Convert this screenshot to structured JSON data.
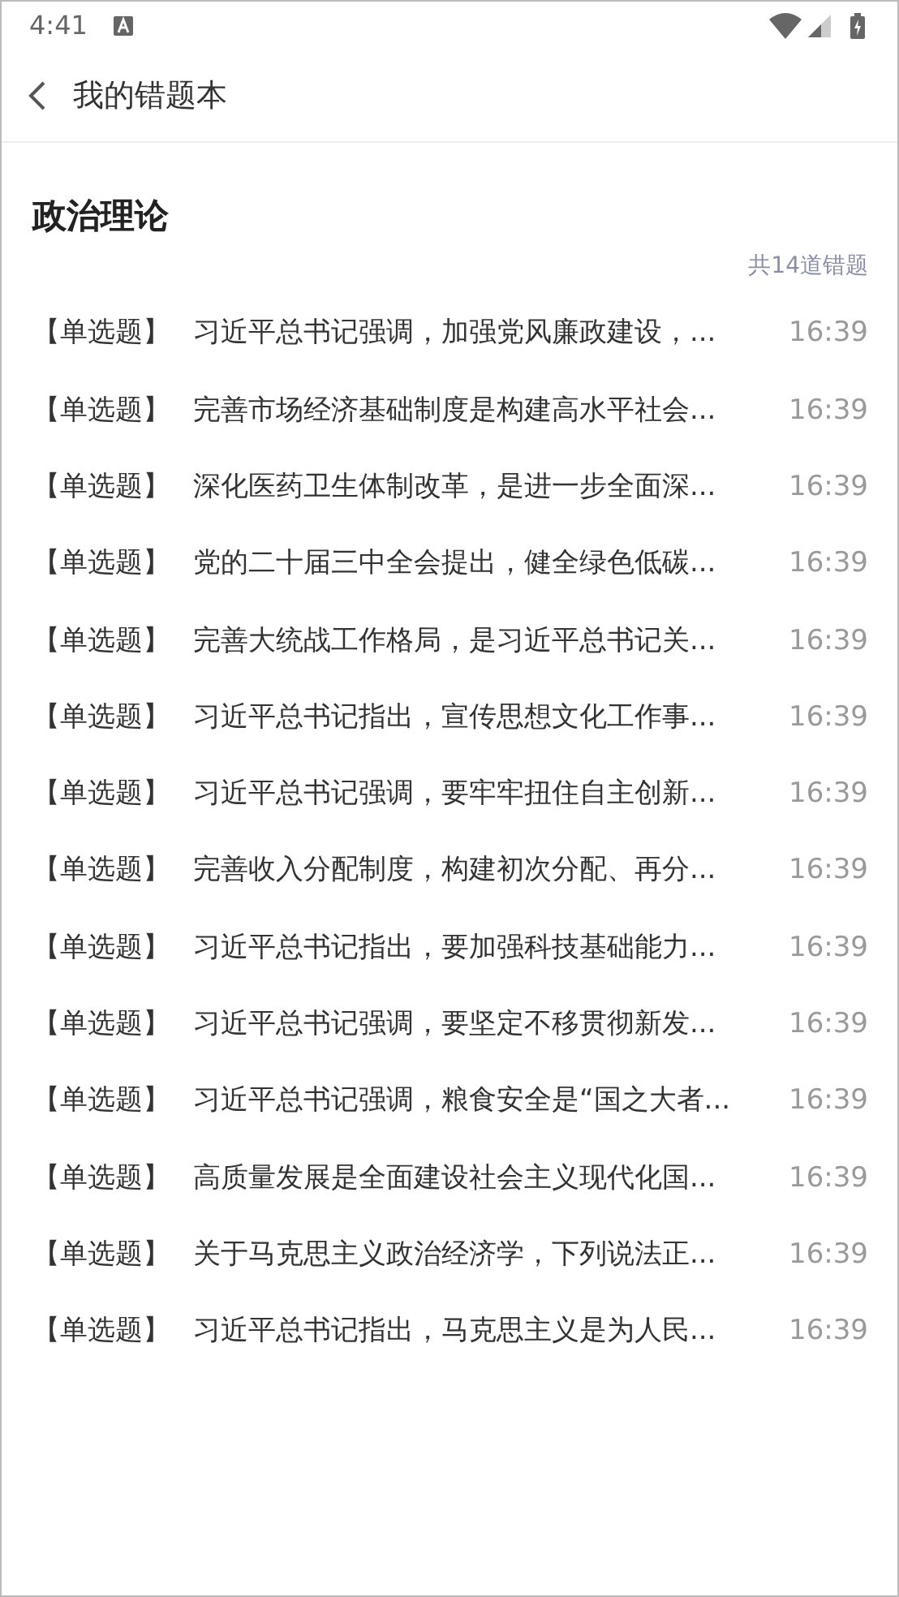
{
  "status_bar": {
    "time": "4:41"
  },
  "header": {
    "title": "我的错题本"
  },
  "section": {
    "title": "政治理论",
    "count": "共14道错题"
  },
  "items": [
    {
      "type": "【单选题】",
      "question": "习近平总书记强调，加强党风廉政建设，...",
      "time": "16:39"
    },
    {
      "type": "【单选题】",
      "question": "完善市场经济基础制度是构建高水平社会...",
      "time": "16:39"
    },
    {
      "type": "【单选题】",
      "question": "深化医药卫生体制改革，是进一步全面深...",
      "time": "16:39"
    },
    {
      "type": "【单选题】",
      "question": "党的二十届三中全会提出，健全绿色低碳...",
      "time": "16:39"
    },
    {
      "type": "【单选题】",
      "question": "完善大统战工作格局，是习近平总书记关...",
      "time": "16:39"
    },
    {
      "type": "【单选题】",
      "question": "习近平总书记指出，宣传思想文化工作事...",
      "time": "16:39"
    },
    {
      "type": "【单选题】",
      "question": "习近平总书记强调，要牢牢扭住自主创新...",
      "time": "16:39"
    },
    {
      "type": "【单选题】",
      "question": "完善收入分配制度，构建初次分配、再分...",
      "time": "16:39"
    },
    {
      "type": "【单选题】",
      "question": "习近平总书记指出，要加强科技基础能力...",
      "time": "16:39"
    },
    {
      "type": "【单选题】",
      "question": "习近平总书记强调，要坚定不移贯彻新发...",
      "time": "16:39"
    },
    {
      "type": "【单选题】",
      "question": "习近平总书记强调，粮食安全是“国之大者...",
      "time": "16:39"
    },
    {
      "type": "【单选题】",
      "question": "高质量发展是全面建设社会主义现代化国...",
      "time": "16:39"
    },
    {
      "type": "【单选题】",
      "question": "关于马克思主义政治经济学，下列说法正...",
      "time": "16:39"
    },
    {
      "type": "【单选题】",
      "question": "习近平总书记指出，马克思主义是为人民...",
      "time": "16:39"
    }
  ]
}
